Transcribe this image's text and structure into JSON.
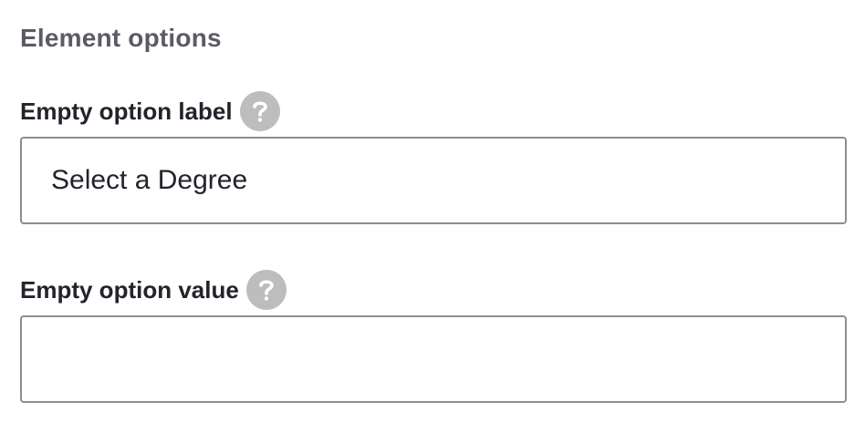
{
  "section": {
    "title": "Element options"
  },
  "fields": [
    {
      "label": "Empty option label",
      "value": "Select a Degree",
      "placeholder": "",
      "help_icon": "question-mark-icon"
    },
    {
      "label": "Empty option value",
      "value": "",
      "placeholder": "",
      "help_icon": "question-mark-icon"
    }
  ],
  "colors": {
    "title": "#5b5b66",
    "label": "#23232b",
    "help_icon_bg": "#bdbdbd",
    "input_border": "#8d8d95"
  }
}
